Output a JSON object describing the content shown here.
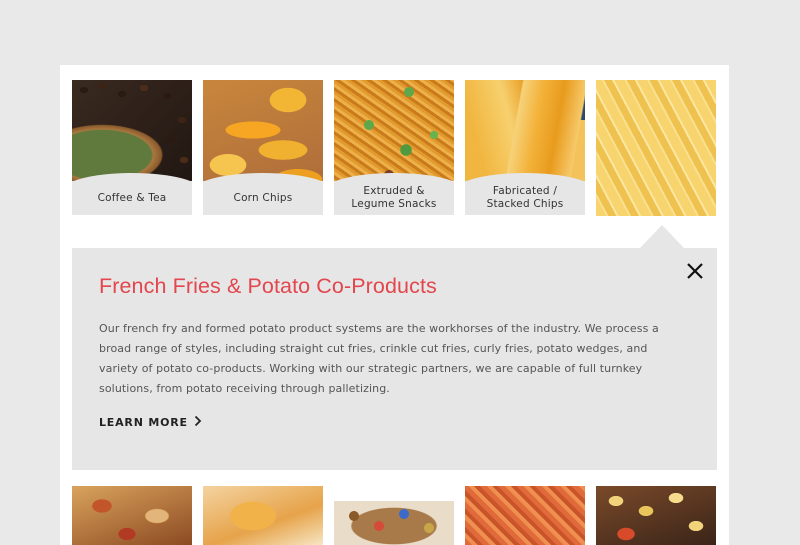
{
  "categories_top": [
    {
      "label": "Coffee & Tea"
    },
    {
      "label": "Corn Chips"
    },
    {
      "label": "Extruded & Legume Snacks"
    },
    {
      "label": "Fabricated / Stacked Chips"
    },
    {
      "label": ""
    }
  ],
  "detail": {
    "title": "French Fries & Potato Co-Products",
    "description": "Our french fry and formed potato product systems are the workhorses of the industry. We process a broad range of styles, including straight cut fries, crinkle cut fries, curly fries, potato wedges, and variety of potato co-products. Working with our strategic partners, we are capable of full turnkey solutions, from potato receiving through palletizing.",
    "learn_more": "LEARN MORE",
    "close_icon": "close-icon",
    "chevron_icon": "chevron-right-icon"
  },
  "colors": {
    "background": "#e9e9e9",
    "panel": "#ffffff",
    "caption_bg": "#e6e6e6",
    "accent_title": "#e3464d"
  }
}
